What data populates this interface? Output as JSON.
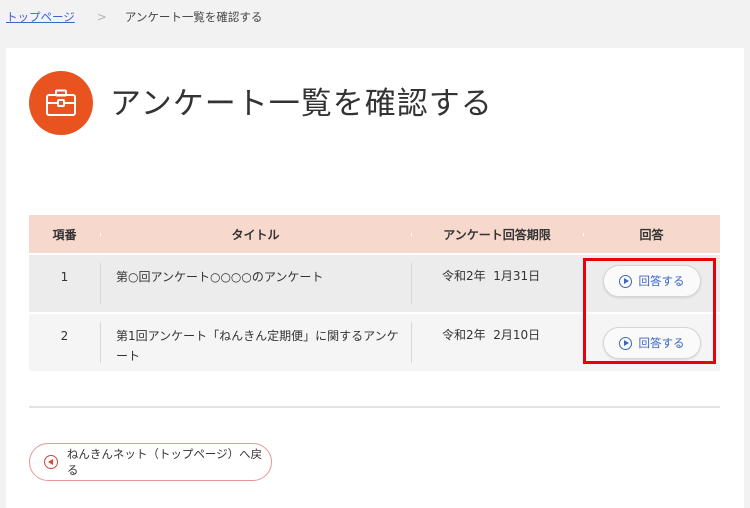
{
  "breadcrumb": {
    "home_label": "トップページ",
    "separator": ">",
    "current_label": "アンケート一覧を確認する"
  },
  "page": {
    "title": "アンケート一覧を確認する",
    "title_icon": "briefcase-icon",
    "accent_color": "#e8531f"
  },
  "table": {
    "headers": [
      "項番",
      "タイトル",
      "アンケート回答期限",
      "回答"
    ],
    "rows": [
      {
        "number": "1",
        "title": "第○回アンケート○○○○のアンケート",
        "deadline": "令和2年  1月31日",
        "action_label": "回答する"
      },
      {
        "number": "2",
        "title": "第1回アンケート「ねんきん定期便」に関するアンケート",
        "deadline": "令和2年  2月10日",
        "action_label": "回答する"
      }
    ],
    "header_color": "#f6d8cd",
    "highlight_color": "#e8000b"
  },
  "footer": {
    "back_label": "ねんきんネット（トップページ）へ戻る",
    "back_icon": "circle-left-arrow-icon"
  }
}
